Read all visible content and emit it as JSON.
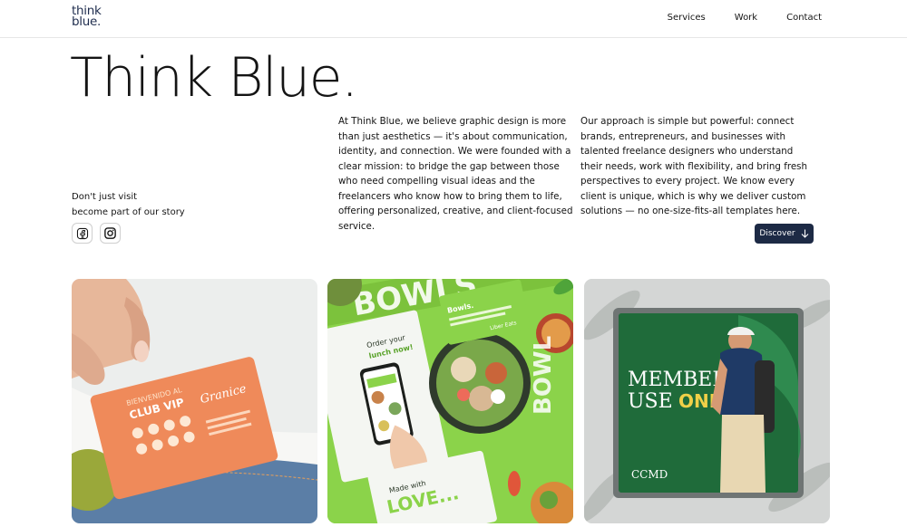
{
  "header": {
    "logo_line1": "think",
    "logo_line2": "blue.",
    "nav": [
      "Services",
      "Work",
      "Contact"
    ]
  },
  "hero": {
    "title": "Think Blue.",
    "tagline_line1": "Don't just visit",
    "tagline_line2": "become part of our story",
    "paragraph_1": "At Think Blue, we believe graphic design is more than just aesthetics — it's about communication, identity, and connection. We were founded with a clear mission: to bridge the gap between those who need compelling visual ideas and the freelancers who know how to bring them to life, offering personalized, creative, and client-focused service.",
    "paragraph_2": "Our approach is simple but powerful: connect brands, entrepreneurs, and businesses with talented freelance designers who understand their needs, work with flexibility, and bring fresh perspectives to every project. We know every client is unique, which is why we deliver custom solutions — no one-size-fits-all templates here.",
    "discover_label": "Discover",
    "socials": [
      "facebook-icon",
      "instagram-icon"
    ]
  },
  "gallery": {
    "card1": {
      "line1": "CLUB VIP",
      "brand": "Granice"
    },
    "card2": {
      "banner": "BOWLS",
      "order_line1": "Order your",
      "order_line2": "lunch now!",
      "love_line1": "Made with",
      "love_line2": "LOVE...",
      "bowls": "Bowls.",
      "liber": "Liber Eats"
    },
    "card3": {
      "line1": "MEMBER",
      "line2a": "USE ",
      "line2b": "ONLY",
      "brand": "CCMD"
    }
  },
  "colors": {
    "accent": "#1d2a45",
    "logo": "#1f2d4e",
    "lime": "#8bd34a",
    "orange": "#ef8a5a",
    "club_green": "#1f6b3a"
  }
}
